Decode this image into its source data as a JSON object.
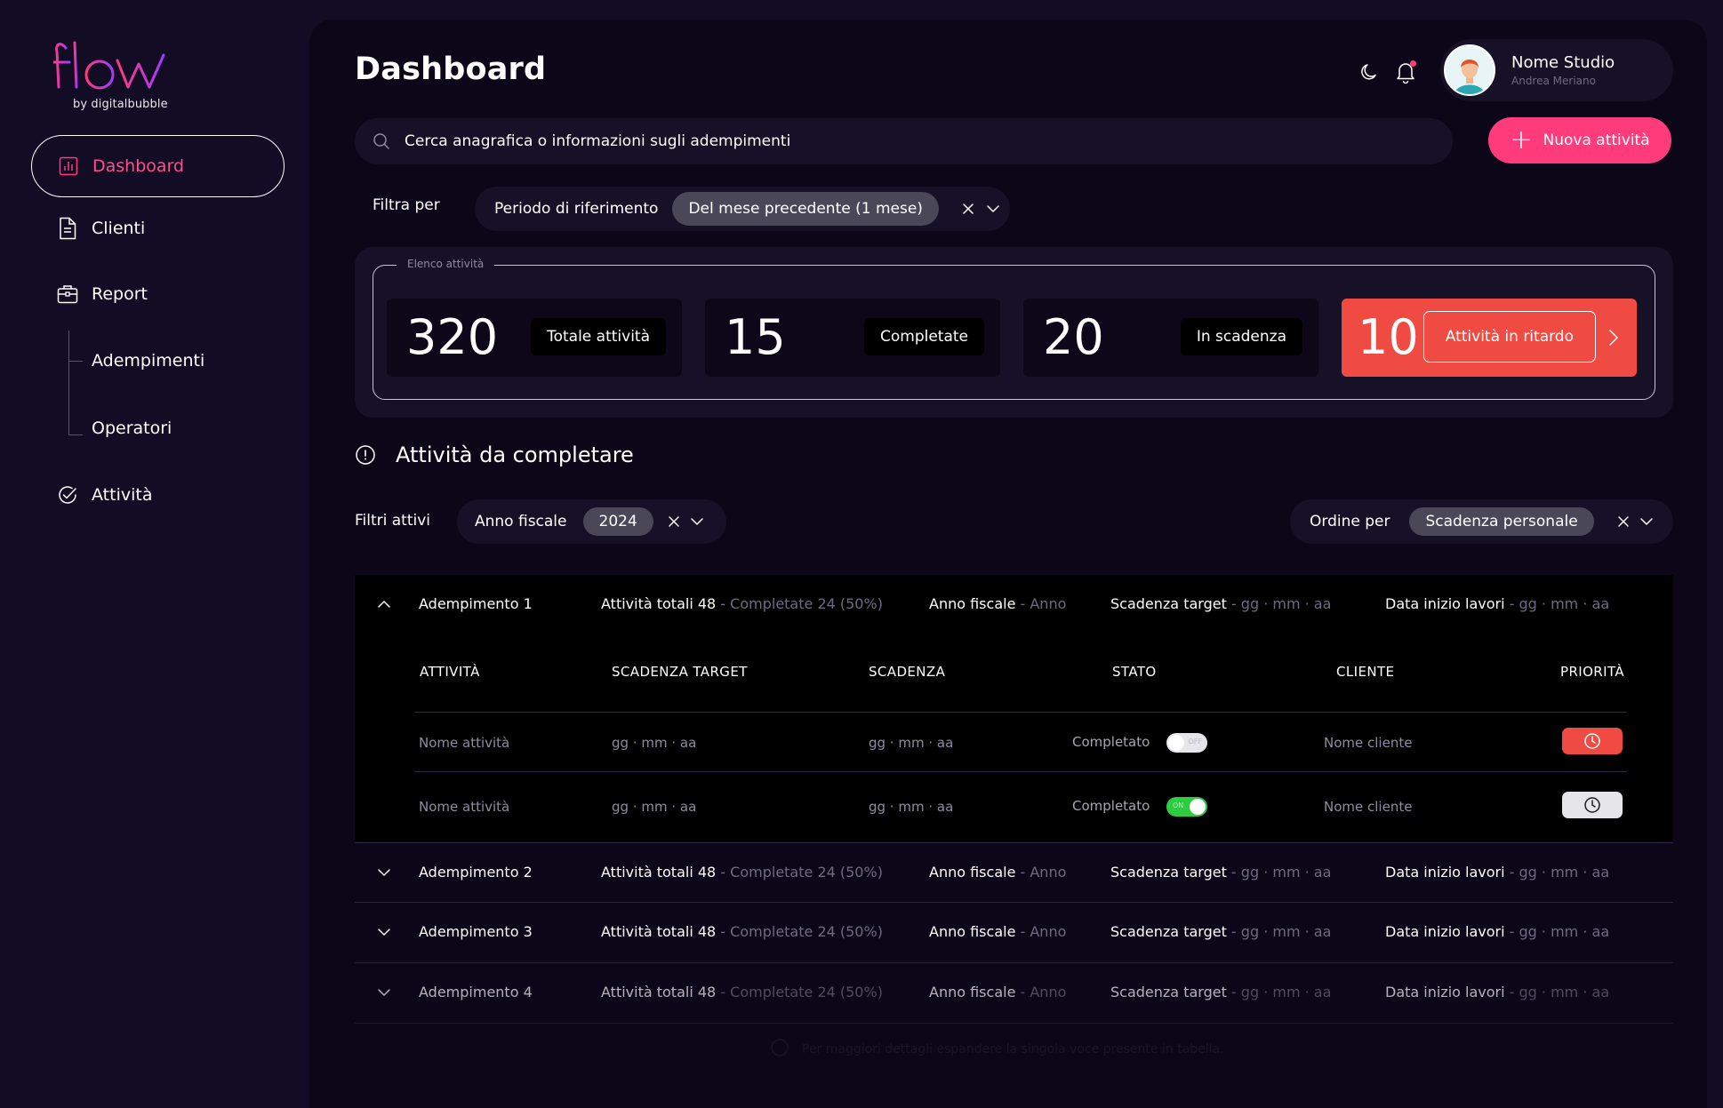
{
  "brand": {
    "logo_text": "flow",
    "tagline": "by digitalbubble",
    "accent": "#ff3b7b",
    "logo_gradient": [
      "#ff3b7b",
      "#a23bff"
    ]
  },
  "sidebar": {
    "items": [
      {
        "label": "Dashboard",
        "icon": "bar-chart-icon",
        "active": true
      },
      {
        "label": "Clienti",
        "icon": "document-icon",
        "active": false
      },
      {
        "label": "Report",
        "icon": "briefcase-icon",
        "active": false
      },
      {
        "label": "Adempimenti",
        "icon": "",
        "active": false,
        "sub": true
      },
      {
        "label": "Operatori",
        "icon": "",
        "active": false,
        "sub": true
      },
      {
        "label": "Attività",
        "icon": "check-circle-icon",
        "active": false
      }
    ]
  },
  "header": {
    "title": "Dashboard",
    "user": {
      "name": "Nome Studio",
      "subtitle": "Andrea Meriano"
    }
  },
  "search": {
    "placeholder": "Cerca anagrafica o informazioni sugli adempimenti"
  },
  "actions": {
    "new_label": "Nuova attività"
  },
  "filters": {
    "label": "Filtra per",
    "field": "Periodo  di riferimento",
    "value": "Del mese precedente (1 mese)"
  },
  "stats": {
    "legend": "Elenco attività",
    "items": [
      {
        "value": "320",
        "label": "Totale attività"
      },
      {
        "value": "15",
        "label": "Completate"
      },
      {
        "value": "20",
        "label": "In scadenza"
      },
      {
        "value": "10",
        "label": "Attività in ritardo"
      }
    ]
  },
  "section": {
    "title": "Attività da completare",
    "active_filters_label": "Filtri attivi",
    "fiscal_year_label": "Anno fiscale",
    "fiscal_year_value": "2024",
    "order_label": "Ordine per",
    "order_value": "Scadenza personale"
  },
  "table": {
    "columns": [
      "ATTIVITÀ",
      "SCADENZA TARGET",
      "SCADENZA",
      "STATO",
      "CLIENTE",
      "PRIORITÀ"
    ],
    "groups": [
      {
        "name": "Adempimento 1",
        "totals": "Attività totali 48",
        "completed": " - Completate 24 (50%)",
        "fy_label": "Anno fiscale",
        "fy_value": " - Anno",
        "target_label": "Scadenza target",
        "target_value": " - gg · mm · aa",
        "start_label": "Data inizio lavori",
        "start_value": " - gg · mm · aa",
        "open": true
      },
      {
        "name": "Adempimento 2",
        "totals": "Attività totali 48",
        "completed": " - Completate 24 (50%)",
        "fy_label": "Anno fiscale",
        "fy_value": " - Anno",
        "target_label": "Scadenza target",
        "target_value": " - gg · mm · aa",
        "start_label": "Data inizio lavori",
        "start_value": " - gg · mm · aa",
        "open": false
      },
      {
        "name": "Adempimento 3",
        "totals": "Attività totali 48",
        "completed": " - Completate 24 (50%)",
        "fy_label": "Anno fiscale",
        "fy_value": " - Anno",
        "target_label": "Scadenza target",
        "target_value": " - gg · mm · aa",
        "start_label": "Data inizio lavori",
        "start_value": " - gg · mm · aa",
        "open": false
      },
      {
        "name": "Adempimento 4",
        "totals": "Attività totali 48",
        "completed": " - Completate 24 (50%)",
        "fy_label": "Anno fiscale",
        "fy_value": " - Anno",
        "target_label": "Scadenza target",
        "target_value": " - gg · mm · aa",
        "start_label": "Data inizio lavori",
        "start_value": " - gg · mm · aa",
        "open": false
      }
    ],
    "rows": [
      {
        "activity": "Nome attività",
        "target": "gg · mm · aa",
        "due": "gg · mm · aa",
        "status": "Completato",
        "toggle": "off",
        "client": "Nome cliente",
        "priority": "high"
      },
      {
        "activity": "Nome attività",
        "target": "gg · mm · aa",
        "due": "gg · mm · aa",
        "status": "Completato",
        "toggle": "on",
        "client": "Nome cliente",
        "priority": "normal"
      }
    ],
    "toggle_off_text": "OFF",
    "toggle_on_text": "ON",
    "colors": {
      "priority_high": "#ef4b43",
      "priority_normal": "#e6e6ea",
      "toggle_on": "#2ecc40",
      "toggle_off": "#e6e6ea"
    }
  },
  "footer_hint": "Per maggiori dettagli espandere la singola voce presente in tabella."
}
